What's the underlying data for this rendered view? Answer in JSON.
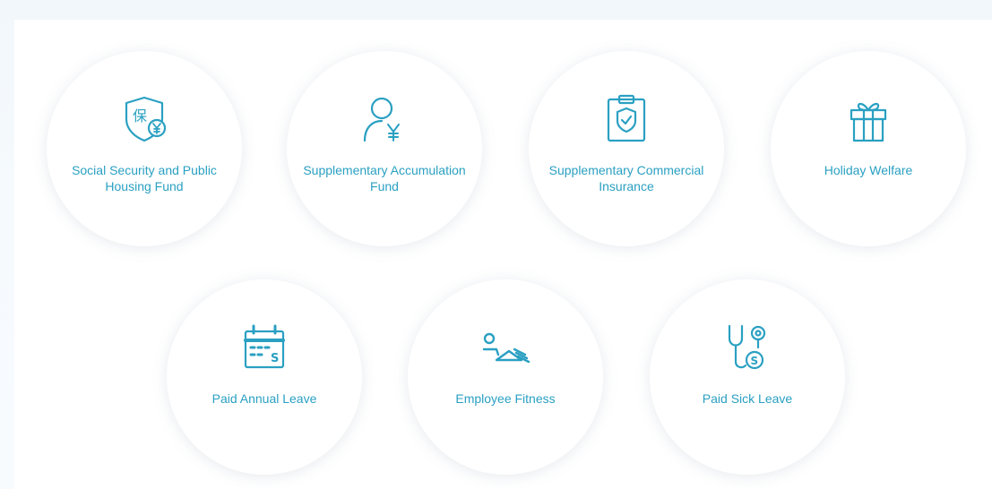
{
  "benefits": [
    {
      "label": "Social Security and Public Housing Fund",
      "icon": "social-security-icon"
    },
    {
      "label": "Supplementary Accumulation Fund",
      "icon": "accumulation-fund-icon"
    },
    {
      "label": "Supplementary Commercial Insurance",
      "icon": "insurance-clipboard-icon"
    },
    {
      "label": "Holiday Welfare",
      "icon": "gift-icon"
    },
    {
      "label": "Paid Annual Leave",
      "icon": "calendar-icon"
    },
    {
      "label": "Employee Fitness",
      "icon": "fitness-icon"
    },
    {
      "label": "Paid Sick Leave",
      "icon": "stethoscope-icon"
    }
  ],
  "colors": {
    "accent": "#2aa0c2",
    "card_bg": "#ffffff",
    "page_bg": "#f3f8fc"
  }
}
